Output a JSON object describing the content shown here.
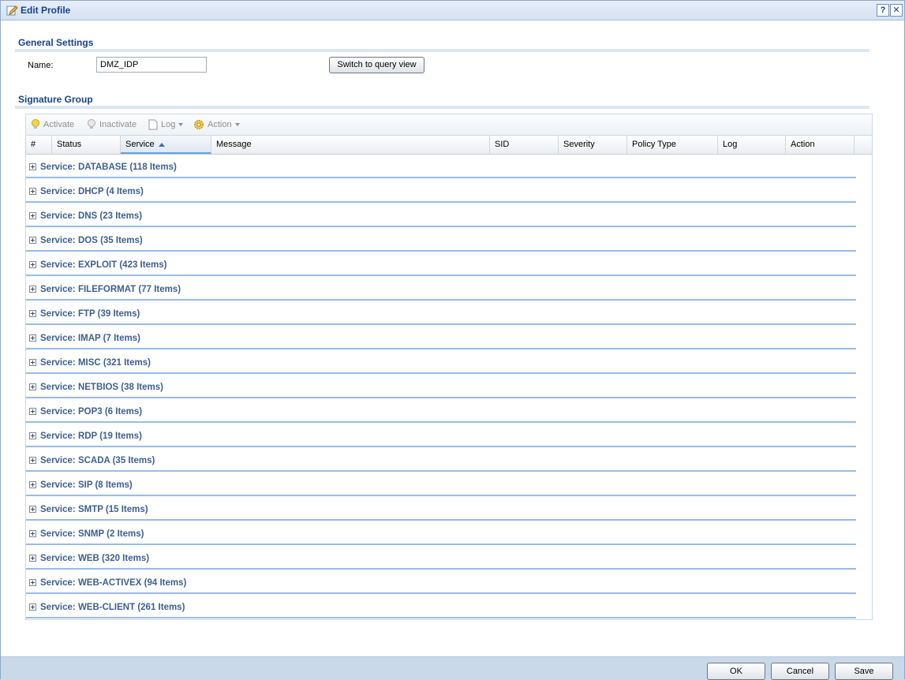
{
  "window": {
    "title": "Edit Profile",
    "help_label": "?",
    "close_label": "✕"
  },
  "general": {
    "title": "General Settings",
    "name_label": "Name:",
    "name_value": "DMZ_IDP",
    "switch_button": "Switch to query view"
  },
  "signature": {
    "title": "Signature Group",
    "toolbar": {
      "activate": "Activate",
      "inactivate": "Inactivate",
      "log": "Log",
      "action": "Action"
    },
    "columns": {
      "num": "#",
      "status": "Status",
      "service": "Service",
      "message": "Message",
      "sid": "SID",
      "severity": "Severity",
      "policy_type": "Policy Type",
      "log": "Log",
      "action": "Action"
    },
    "groups": [
      "Service: DATABASE (118 Items)",
      "Service: DHCP (4 Items)",
      "Service: DNS (23 Items)",
      "Service: DOS (35 Items)",
      "Service: EXPLOIT (423 Items)",
      "Service: FILEFORMAT (77 Items)",
      "Service: FTP (39 Items)",
      "Service: IMAP (7 Items)",
      "Service: MISC (321 Items)",
      "Service: NETBIOS (38 Items)",
      "Service: POP3 (6 Items)",
      "Service: RDP (19 Items)",
      "Service: SCADA (35 Items)",
      "Service: SIP (8 Items)",
      "Service: SMTP (15 Items)",
      "Service: SNMP (2 Items)",
      "Service: WEB (320 Items)",
      "Service: WEB-ACTIVEX (94 Items)",
      "Service: WEB-CLIENT (261 Items)"
    ]
  },
  "footer": {
    "ok": "OK",
    "cancel": "Cancel",
    "save": "Save"
  }
}
